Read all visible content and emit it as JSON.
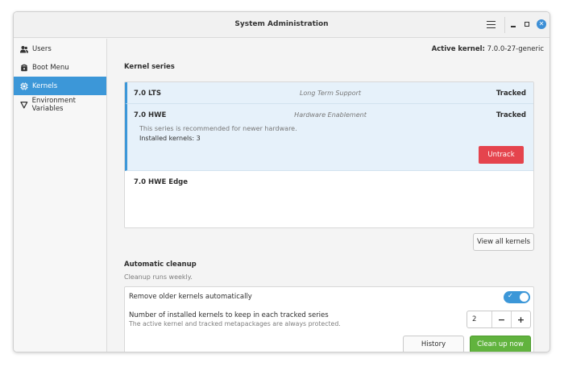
{
  "window": {
    "title": "System Administration"
  },
  "sidebar": {
    "items": [
      {
        "label": "Users",
        "icon": "users-icon",
        "active": false
      },
      {
        "label": "Boot Menu",
        "icon": "boot-menu-icon",
        "active": false
      },
      {
        "label": "Kernels",
        "icon": "chip-icon",
        "active": true
      },
      {
        "label": "Environment Variables",
        "icon": "variable-icon",
        "active": false
      }
    ]
  },
  "header": {
    "active_kernel_label": "Active kernel:",
    "active_kernel_value": "7.0.0-27-generic"
  },
  "kernel_series": {
    "heading": "Kernel series",
    "rows": [
      {
        "name": "7.0 LTS",
        "description": "Long Term Support",
        "status": "Tracked"
      },
      {
        "name": "7.0 HWE",
        "description": "Hardware Enablement",
        "status": "Tracked",
        "detail": "This series is recommended for newer hardware.",
        "installed": "Installed kernels: 3",
        "action": "Untrack"
      },
      {
        "name": "7.0 HWE Edge",
        "description": "",
        "status": ""
      }
    ],
    "view_all_label": "View all kernels"
  },
  "cleanup": {
    "heading": "Automatic cleanup",
    "subtitle": "Cleanup runs weekly.",
    "auto_remove_label": "Remove older kernels automatically",
    "auto_remove_enabled": true,
    "keep_label": "Number of installed kernels to keep in each tracked series",
    "keep_sub": "The active kernel and tracked metapackages are always protected.",
    "keep_value": "2",
    "minus": "−",
    "plus": "+",
    "history_label": "History",
    "cleanup_now_label": "Clean up now"
  },
  "colors": {
    "accent": "#3c97d8",
    "danger": "#e5444d",
    "success": "#61b33e"
  }
}
